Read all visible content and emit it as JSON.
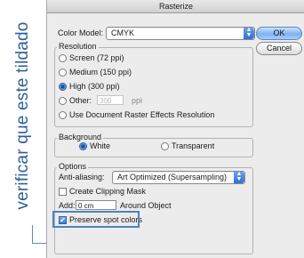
{
  "annotation": {
    "text": "verificar que este tildado"
  },
  "window": {
    "title": "Rasterize"
  },
  "color_model": {
    "label": "Color Model:",
    "value": "CMYK"
  },
  "buttons": {
    "ok": "OK",
    "cancel": "Cancel"
  },
  "resolution": {
    "title": "Resolution",
    "options": [
      "Screen (72 ppi)",
      "Medium (150 ppi)",
      "High (300 ppi)"
    ],
    "selected": "High (300 ppi)",
    "other_label": "Other:",
    "other_value": "300",
    "other_unit": "ppi",
    "doc_label": "Use Document Raster Effects Resolution"
  },
  "background": {
    "title": "Background",
    "white": "White",
    "transparent": "Transparent",
    "selected": "White"
  },
  "options": {
    "title": "Options",
    "antialias_label": "Anti-aliasing:",
    "antialias_value": "Art Optimized (Supersampling)",
    "clipping_label": "Create Clipping Mask",
    "add_label": "Add:",
    "add_value": "0 cm",
    "around_label": "Around Object",
    "spot_label": "Preserve spot colors",
    "spot_checked": true
  }
}
